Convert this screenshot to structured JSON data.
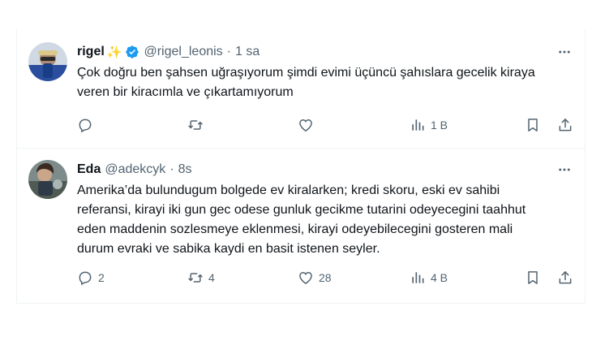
{
  "tweets": [
    {
      "name": "rigel",
      "handle": "@rigel_leonis",
      "time": "1 sa",
      "text": "Çok doğru ben şahsen uğraşıyorum şimdi evimi üçüncü şahıslara gecelik kiraya veren bir kiracımla ve çıkartamıyorum",
      "replies": "",
      "retweets": "",
      "likes": "",
      "views": "1 B"
    },
    {
      "name": "Eda",
      "handle": "@adekcyk",
      "time": "8s",
      "text": "Amerika’da bulundugum bolgede ev kiralarken; kredi skoru, eski ev sahibi referansi, kirayi iki gun gec odese gunluk gecikme tutarini odeyecegini taahhut eden maddenin sozlesmeye eklenmesi, kirayi odeyebilecegini gosteren mali durum evraki ve sabika kaydi en basit istenen seyler.",
      "replies": "2",
      "retweets": "4",
      "likes": "28",
      "views": "4 B"
    }
  ],
  "colors": {
    "icon": "#536471",
    "verified": "#1d9bf0",
    "sparkle": "#f4b400",
    "border": "#eff3f4"
  },
  "icons": [
    "reply-icon",
    "retweet-icon",
    "like-icon",
    "views-icon",
    "bookmark-icon",
    "share-icon",
    "more-icon",
    "verified-badge-icon"
  ]
}
